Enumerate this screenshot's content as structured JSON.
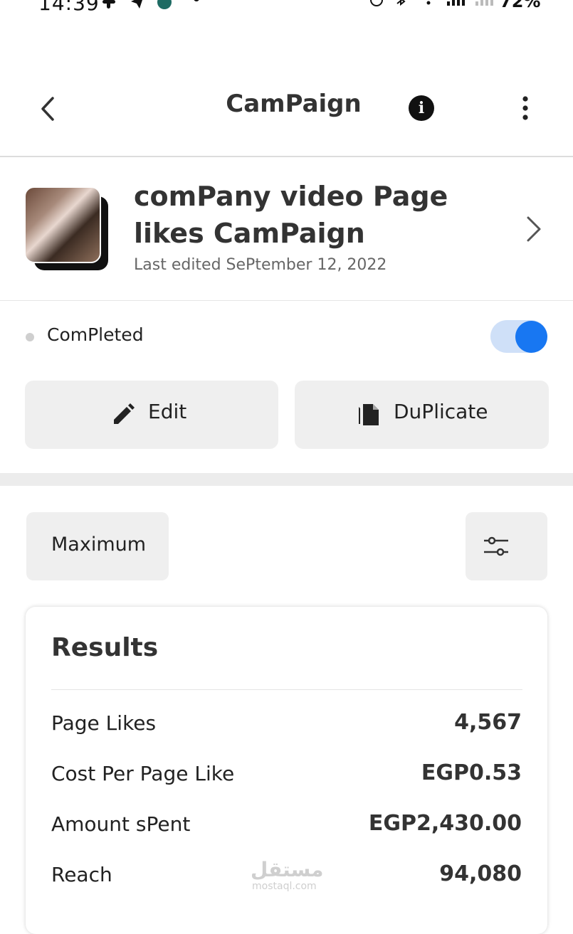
{
  "status_bar": {
    "time": "14:39",
    "battery": "72%"
  },
  "header": {
    "title": "CamPaign"
  },
  "campaign": {
    "title": "comPany video Page likes CamPaign",
    "last_edited": "Last edited SePtember 12, 2022"
  },
  "status": {
    "label": "ComPleted",
    "toggle_on": true
  },
  "actions": {
    "edit_label": "Edit",
    "duplicate_label": "DuPlicate"
  },
  "filter": {
    "range_label": "Maximum"
  },
  "results": {
    "title": "Results",
    "rows": [
      {
        "label": "Page Likes",
        "value": "4,567"
      },
      {
        "label": "Cost Per Page Like",
        "value": "EGP0.53"
      },
      {
        "label": "Amount sPent",
        "value": "EGP2,430.00"
      },
      {
        "label": "Reach",
        "value": "94,080"
      }
    ]
  },
  "watermark": {
    "text": "مستقل",
    "sub": "mostaql.com"
  },
  "colors": {
    "accent": "#1877f2",
    "toggle_track": "#cfe0f8",
    "button_bg": "#efefef"
  }
}
